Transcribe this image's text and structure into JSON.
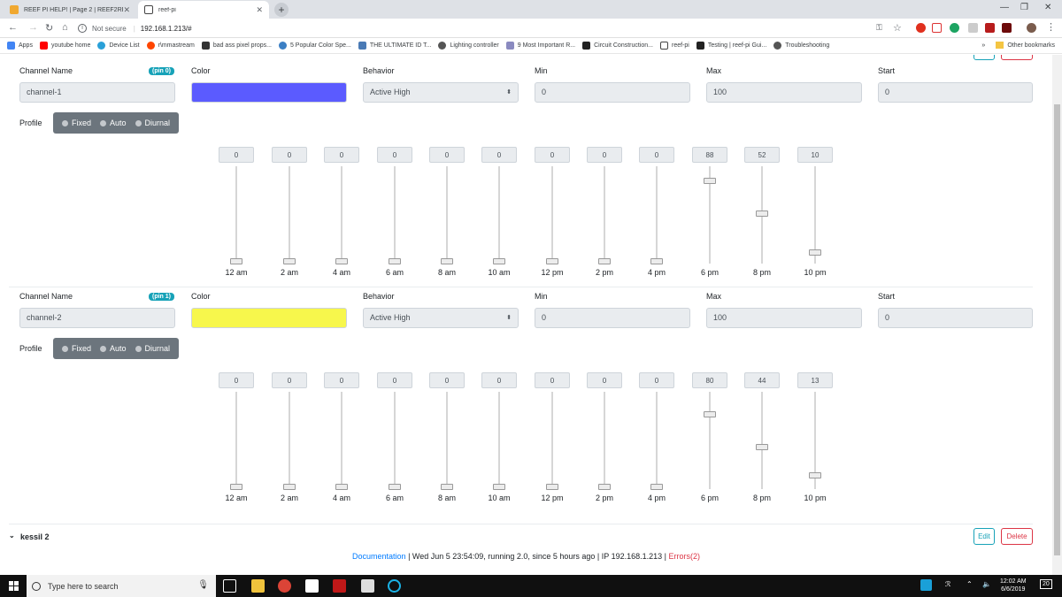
{
  "browser": {
    "tabs": [
      {
        "title": "REEF PI HELP! | Page 2 | REEF2REEF",
        "active": false
      },
      {
        "title": "reef-pi",
        "active": true
      }
    ],
    "security_label": "Not secure",
    "url": "192.168.1.213/#",
    "bookmarks": [
      "Apps",
      "youtube home",
      "Device List",
      "r\\mmastream",
      "bad ass pixel props...",
      "5 Popular Color Spe...",
      "THE ULTIMATE ID T...",
      "Lighting controller",
      "9 Most Important R...",
      "Circuit Construction...",
      "reef-pi",
      "Testing | reef-pi Gui...",
      "Troubleshooting"
    ],
    "bookmarks_overflow": "»",
    "other_bookmarks": "Other bookmarks"
  },
  "labels": {
    "channel_name": "Channel Name",
    "color": "Color",
    "behavior": "Behavior",
    "min": "Min",
    "max": "Max",
    "start": "Start",
    "profile": "Profile"
  },
  "profile_options": [
    "Fixed",
    "Auto",
    "Diurnal"
  ],
  "time_labels": [
    "12 am",
    "2 am",
    "4 am",
    "6 am",
    "8 am",
    "10 am",
    "12 pm",
    "2 pm",
    "4 pm",
    "6 pm",
    "8 pm",
    "10 pm"
  ],
  "channels": [
    {
      "pin": "(pin 0)",
      "name": "channel-1",
      "color": "#5b5bff",
      "behavior": "Active High",
      "min": "0",
      "max": "100",
      "start": "0",
      "values": [
        0,
        0,
        0,
        0,
        0,
        0,
        0,
        0,
        0,
        88,
        52,
        10
      ]
    },
    {
      "pin": "(pin 1)",
      "name": "channel-2",
      "color": "#f7f74c",
      "behavior": "Active High",
      "min": "0",
      "max": "100",
      "start": "0",
      "values": [
        0,
        0,
        0,
        0,
        0,
        0,
        0,
        0,
        0,
        80,
        44,
        13
      ]
    }
  ],
  "light": {
    "name": "kessil 2",
    "edit_label": "Edit",
    "delete_label": "Delete"
  },
  "footer": {
    "documentation": "Documentation",
    "status": "| Wed Jun 5 23:54:09, running 2.0, since 5 hours ago | IP 192.168.1.213 |",
    "errors": "Errors(2)"
  },
  "taskbar": {
    "search_placeholder": "Type here to search",
    "time": "12:02 AM",
    "date": "6/6/2019",
    "notification_count": "20"
  }
}
